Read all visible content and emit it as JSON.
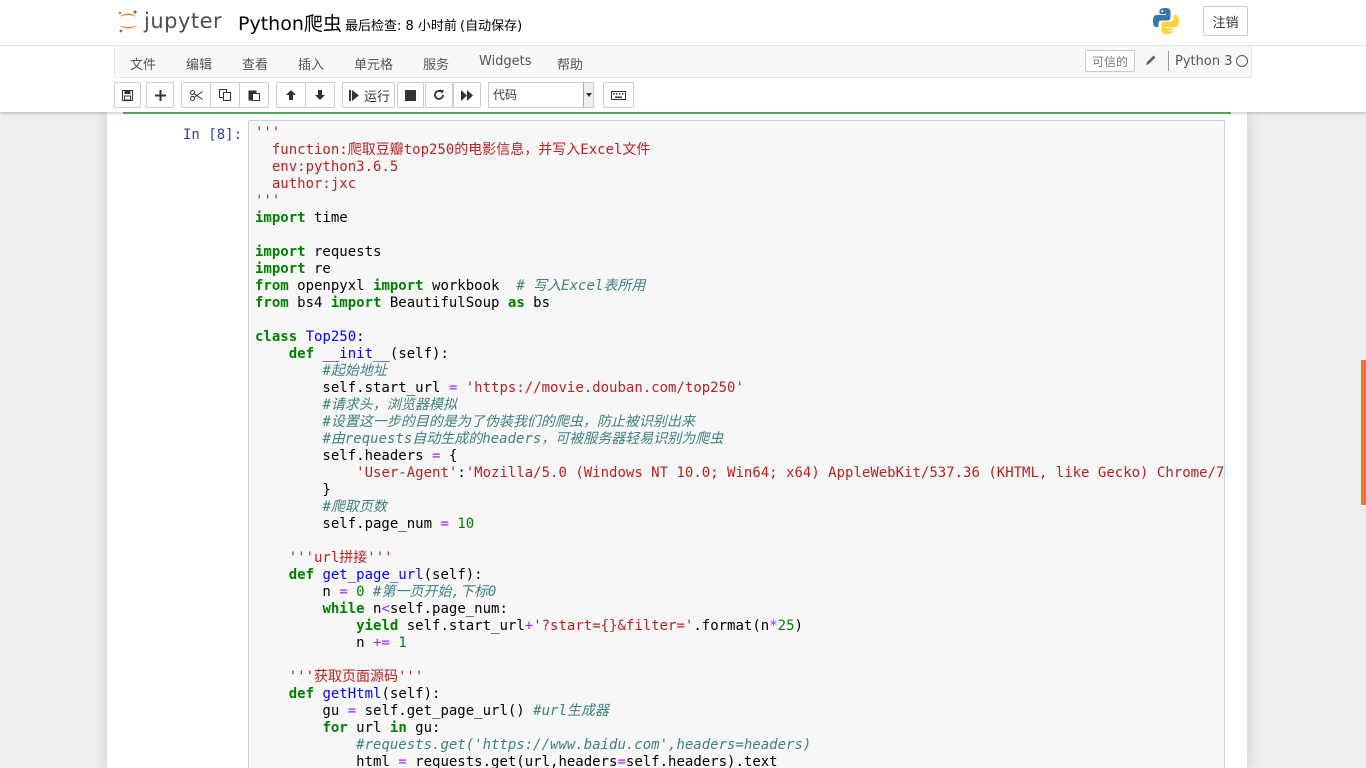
{
  "header": {
    "logo_text": "jupyter",
    "notebook_title": "Python爬虫",
    "checkpoint": "最后检查: 8 小时前",
    "autosave": "(自动保存)",
    "logout": "注销"
  },
  "menubar": {
    "items": [
      "文件",
      "编辑",
      "查看",
      "插入",
      "单元格",
      "服务",
      "Widgets",
      "帮助"
    ],
    "trusted": "可信的",
    "kernel": "Python 3"
  },
  "toolbar": {
    "run_label": "运行",
    "cell_type": "代码"
  },
  "cell": {
    "prompt": "In [8]:"
  },
  "colors": {
    "string": "#ba2121",
    "keyword": "#008000",
    "comment": "#408080",
    "operator": "#aa22ff",
    "function_name": "#0000ff",
    "prompt": "#303f9f",
    "accent_orange": "#f0742c"
  },
  "icons": [
    "save-icon",
    "plus-icon",
    "cut-icon",
    "copy-icon",
    "paste-icon",
    "arrow-up-icon",
    "arrow-down-icon",
    "step-forward-icon",
    "stop-icon",
    "restart-icon",
    "fast-forward-icon",
    "keyboard-icon",
    "pencil-icon",
    "python-logo-icon",
    "jupyter-logo-icon"
  ],
  "code_lines": [
    [
      [
        "s",
        "'''"
      ]
    ],
    [
      [
        "s",
        "  function:爬取豆瓣top250的电影信息，并写入Excel文件"
      ]
    ],
    [
      [
        "s",
        "  env:python3.6.5"
      ]
    ],
    [
      [
        "s",
        "  author:jxc"
      ]
    ],
    [
      [
        "s",
        "'''"
      ]
    ],
    [
      [
        "k",
        "import"
      ],
      [
        "",
        " time"
      ]
    ],
    [],
    [
      [
        "k",
        "import"
      ],
      [
        "",
        " requests"
      ]
    ],
    [
      [
        "k",
        "import"
      ],
      [
        "",
        " re"
      ]
    ],
    [
      [
        "k",
        "from"
      ],
      [
        "",
        " openpyxl "
      ],
      [
        "k",
        "import"
      ],
      [
        "",
        " workbook  "
      ],
      [
        "c",
        "# 写入Excel表所用"
      ]
    ],
    [
      [
        "k",
        "from"
      ],
      [
        "",
        " bs4 "
      ],
      [
        "k",
        "import"
      ],
      [
        "",
        " BeautifulSoup "
      ],
      [
        "k",
        "as"
      ],
      [
        "",
        " bs"
      ]
    ],
    [],
    [
      [
        "k",
        "class"
      ],
      [
        "",
        " "
      ],
      [
        "nc",
        "Top250"
      ],
      [
        "",
        ":"
      ]
    ],
    [
      [
        "",
        "    "
      ],
      [
        "k",
        "def"
      ],
      [
        "",
        " "
      ],
      [
        "nf",
        "__init__"
      ],
      [
        "",
        "(self):"
      ]
    ],
    [
      [
        "",
        "        "
      ],
      [
        "c",
        "#起始地址"
      ]
    ],
    [
      [
        "",
        "        self.start_url "
      ],
      [
        "o",
        "="
      ],
      [
        "",
        " "
      ],
      [
        "s",
        "'https://movie.douban.com/top250'"
      ]
    ],
    [
      [
        "",
        "        "
      ],
      [
        "c",
        "#请求头，浏览器模拟"
      ]
    ],
    [
      [
        "",
        "        "
      ],
      [
        "c",
        "#设置这一步的目的是为了伪装我们的爬虫，防止被识别出来"
      ]
    ],
    [
      [
        "",
        "        "
      ],
      [
        "c",
        "#由requests自动生成的headers，可被服务器轻易识别为爬虫"
      ]
    ],
    [
      [
        "",
        "        self.headers "
      ],
      [
        "o",
        "="
      ],
      [
        "",
        " {"
      ]
    ],
    [
      [
        "",
        "            "
      ],
      [
        "s",
        "'User-Agent'"
      ],
      [
        "",
        ":"
      ],
      [
        "s",
        "'Mozilla/5.0 (Windows NT 10.0; Win64; x64) AppleWebKit/537.36 (KHTML, like Gecko) Chrome/7"
      ]
    ],
    [
      [
        "",
        "        }"
      ]
    ],
    [
      [
        "",
        "        "
      ],
      [
        "c",
        "#爬取页数"
      ]
    ],
    [
      [
        "",
        "        self.page_num "
      ],
      [
        "o",
        "="
      ],
      [
        "",
        " "
      ],
      [
        "m",
        "10"
      ]
    ],
    [],
    [
      [
        "",
        "    "
      ],
      [
        "s",
        "'''url拼接'''"
      ]
    ],
    [
      [
        "",
        "    "
      ],
      [
        "k",
        "def"
      ],
      [
        "",
        " "
      ],
      [
        "nf",
        "get_page_url"
      ],
      [
        "",
        "(self):"
      ]
    ],
    [
      [
        "",
        "        n "
      ],
      [
        "o",
        "="
      ],
      [
        "",
        " "
      ],
      [
        "m",
        "0"
      ],
      [
        "",
        " "
      ],
      [
        "c",
        "#第一页开始,下标0"
      ]
    ],
    [
      [
        "",
        "        "
      ],
      [
        "k",
        "while"
      ],
      [
        "",
        " n"
      ],
      [
        "o",
        "<"
      ],
      [
        "",
        "self.page_num:"
      ]
    ],
    [
      [
        "",
        "            "
      ],
      [
        "k",
        "yield"
      ],
      [
        "",
        " self.start_url"
      ],
      [
        "o",
        "+"
      ],
      [
        "s",
        "'?start={}&filter='"
      ],
      [
        "",
        ".format(n"
      ],
      [
        "o",
        "*"
      ],
      [
        "m",
        "25"
      ],
      [
        "",
        ")"
      ]
    ],
    [
      [
        "",
        "            n "
      ],
      [
        "o",
        "+="
      ],
      [
        "",
        " "
      ],
      [
        "m",
        "1"
      ]
    ],
    [],
    [
      [
        "",
        "    "
      ],
      [
        "s",
        "'''获取页面源码'''"
      ]
    ],
    [
      [
        "",
        "    "
      ],
      [
        "k",
        "def"
      ],
      [
        "",
        " "
      ],
      [
        "nf",
        "getHtml"
      ],
      [
        "",
        "(self):"
      ]
    ],
    [
      [
        "",
        "        gu "
      ],
      [
        "o",
        "="
      ],
      [
        "",
        " self.get_page_url() "
      ],
      [
        "c",
        "#url生成器"
      ]
    ],
    [
      [
        "",
        "        "
      ],
      [
        "k",
        "for"
      ],
      [
        "",
        " url "
      ],
      [
        "k",
        "in"
      ],
      [
        "",
        " gu:"
      ]
    ],
    [
      [
        "",
        "            "
      ],
      [
        "c",
        "#requests.get('https://www.baidu.com',headers=headers)"
      ]
    ],
    [
      [
        "",
        "            html "
      ],
      [
        "o",
        "="
      ],
      [
        "",
        " requests.get(url,headers"
      ],
      [
        "o",
        "="
      ],
      [
        "",
        "self.headers).text"
      ]
    ]
  ]
}
